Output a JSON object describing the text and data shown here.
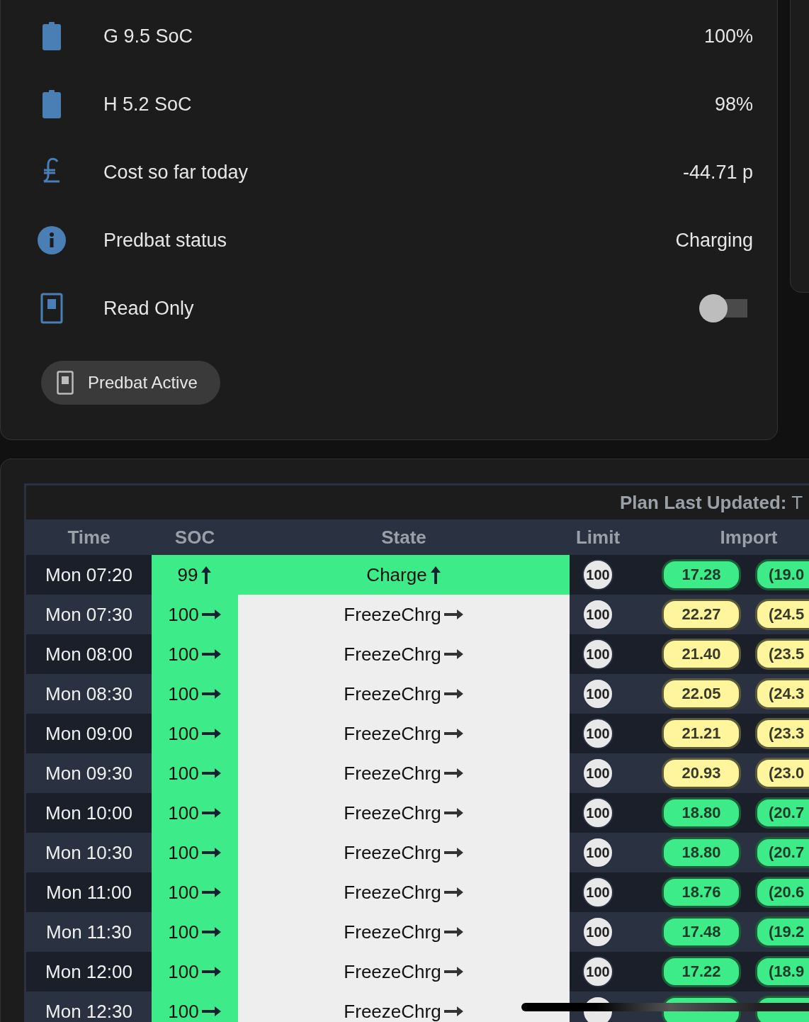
{
  "entities": [
    {
      "kind": "battery",
      "label": "G 9.5 SoC",
      "value": "100%"
    },
    {
      "kind": "battery",
      "label": "H 5.2 SoC",
      "value": "98%"
    },
    {
      "kind": "pound",
      "label": "Cost so far today",
      "value": "-44.71 p"
    },
    {
      "kind": "info",
      "label": "Predbat status",
      "value": "Charging"
    },
    {
      "kind": "switch",
      "label": "Read Only",
      "toggle": {
        "on": false
      }
    }
  ],
  "chip": {
    "label": "Predbat Active"
  },
  "plan": {
    "updated_label": "Plan Last Updated:",
    "updated_value": "T",
    "columns": [
      "Time",
      "SOC",
      "State",
      "Limit",
      "Import"
    ],
    "rows": [
      {
        "kind": "charge",
        "time": "Mon 07:20",
        "soc": "99",
        "state": "Charge",
        "limit": "100",
        "imports": [
          {
            "text": "17.28",
            "color": "#3dec88"
          },
          {
            "text": "(19.0",
            "color": "#3dec88"
          }
        ]
      },
      {
        "kind": "freeze",
        "time": "Mon 07:30",
        "soc": "100",
        "state": "FreezeChrg",
        "limit": "100",
        "imports": [
          {
            "text": "22.27",
            "color": "#fff59d"
          },
          {
            "text": "(24.5",
            "color": "#fff59d"
          }
        ]
      },
      {
        "kind": "freeze",
        "time": "Mon 08:00",
        "soc": "100",
        "state": "FreezeChrg",
        "limit": "100",
        "imports": [
          {
            "text": "21.40",
            "color": "#fff59d"
          },
          {
            "text": "(23.5",
            "color": "#fff59d"
          }
        ]
      },
      {
        "kind": "freeze",
        "time": "Mon 08:30",
        "soc": "100",
        "state": "FreezeChrg",
        "limit": "100",
        "imports": [
          {
            "text": "22.05",
            "color": "#fff59d"
          },
          {
            "text": "(24.3",
            "color": "#fff59d"
          }
        ]
      },
      {
        "kind": "freeze",
        "time": "Mon 09:00",
        "soc": "100",
        "state": "FreezeChrg",
        "limit": "100",
        "imports": [
          {
            "text": "21.21",
            "color": "#fff59d"
          },
          {
            "text": "(23.3",
            "color": "#fff59d"
          }
        ]
      },
      {
        "kind": "freeze",
        "time": "Mon 09:30",
        "soc": "100",
        "state": "FreezeChrg",
        "limit": "100",
        "imports": [
          {
            "text": "20.93",
            "color": "#fff59d"
          },
          {
            "text": "(23.0",
            "color": "#fff59d"
          }
        ]
      },
      {
        "kind": "freeze",
        "time": "Mon 10:00",
        "soc": "100",
        "state": "FreezeChrg",
        "limit": "100",
        "imports": [
          {
            "text": "18.80",
            "color": "#3dec88"
          },
          {
            "text": "(20.7",
            "color": "#3dec88"
          }
        ]
      },
      {
        "kind": "freeze",
        "time": "Mon 10:30",
        "soc": "100",
        "state": "FreezeChrg",
        "limit": "100",
        "imports": [
          {
            "text": "18.80",
            "color": "#3dec88"
          },
          {
            "text": "(20.7",
            "color": "#3dec88"
          }
        ]
      },
      {
        "kind": "freeze",
        "time": "Mon 11:00",
        "soc": "100",
        "state": "FreezeChrg",
        "limit": "100",
        "imports": [
          {
            "text": "18.76",
            "color": "#3dec88"
          },
          {
            "text": "(20.6",
            "color": "#3dec88"
          }
        ]
      },
      {
        "kind": "freeze",
        "time": "Mon 11:30",
        "soc": "100",
        "state": "FreezeChrg",
        "limit": "100",
        "imports": [
          {
            "text": "17.48",
            "color": "#3dec88"
          },
          {
            "text": "(19.2",
            "color": "#3dec88"
          }
        ]
      },
      {
        "kind": "freeze",
        "time": "Mon 12:00",
        "soc": "100",
        "state": "FreezeChrg",
        "limit": "100",
        "imports": [
          {
            "text": "17.22",
            "color": "#3dec88"
          },
          {
            "text": "(18.9",
            "color": "#3dec88"
          }
        ]
      },
      {
        "kind": "freeze",
        "time": "Mon 12:30",
        "soc": "100",
        "state": "FreezeChrg",
        "imports": [
          {
            "color": "#3dec88"
          },
          {
            "color": "#3dec88"
          }
        ]
      }
    ]
  }
}
